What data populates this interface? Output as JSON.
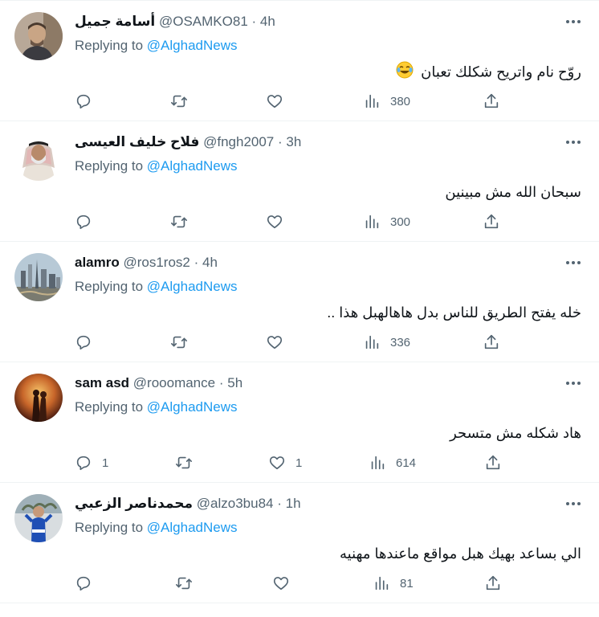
{
  "colors": {
    "link": "#1d9bf0",
    "muted": "#536471",
    "text": "#0f1419",
    "divider": "#eff3f4"
  },
  "tweets": [
    {
      "name": "أسامة جميل",
      "handle": "@OSAMKO81",
      "time": "4h",
      "replying_prefix": "Replying to",
      "replying_handle": "@AlghadNews",
      "text": "روّح نام واتريح شكلك تعبان",
      "emoji": "tears-of-joy-emoji",
      "replies": "",
      "retweets": "",
      "likes": "",
      "views": "380"
    },
    {
      "name": "فلاح خليف العيسى",
      "handle": "@fngh2007",
      "time": "3h",
      "replying_prefix": "Replying to",
      "replying_handle": "@AlghadNews",
      "text": "سبحان الله مش مبينين",
      "replies": "",
      "retweets": "",
      "likes": "",
      "views": "300"
    },
    {
      "name": "alamro",
      "handle": "@ros1ros2",
      "time": "4h",
      "replying_prefix": "Replying to",
      "replying_handle": "@AlghadNews",
      "text": "خله يفتح الطريق للناس بدل هاهالهبل هذا ..",
      "replies": "",
      "retweets": "",
      "likes": "",
      "views": "336"
    },
    {
      "name": "sam asd",
      "handle": "@rooomance",
      "time": "5h",
      "replying_prefix": "Replying to",
      "replying_handle": "@AlghadNews",
      "text": "هاد شكله مش متسحر",
      "replies": "1",
      "retweets": "",
      "likes": "1",
      "views": "614"
    },
    {
      "name": "محمدناصر الزعبي",
      "handle": "@alzo3bu84",
      "time": "1h",
      "replying_prefix": "Replying to",
      "replying_handle": "@AlghadNews",
      "text": "الي بساعد بهيك هبل مواقع ماعندها مهنيه",
      "replies": "",
      "retweets": "",
      "likes": "",
      "views": "81"
    }
  ]
}
